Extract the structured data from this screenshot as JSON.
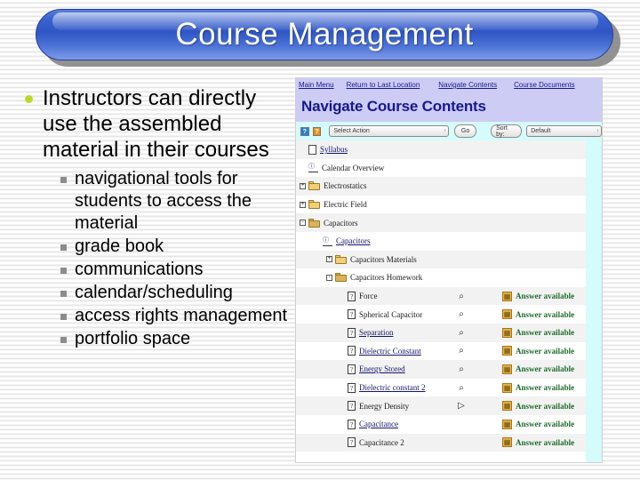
{
  "slide": {
    "title": "Course Management",
    "bullets": [
      {
        "level": 1,
        "text": "Instructors can directly use the assembled material in their courses"
      }
    ],
    "subbullets": [
      "navigational tools for students to access the material",
      "grade book",
      "communications",
      "calendar/scheduling",
      "access rights management",
      "portfolio space"
    ]
  },
  "screenshot": {
    "nav_links": [
      "Main Menu",
      "Return to Last Location",
      "Navigate Contents",
      "Course Documents"
    ],
    "page_header": "Navigate Course Contents",
    "toolbar": {
      "help_blue": "?",
      "help_orange": "?",
      "select_action": "Select Action",
      "go": "Go",
      "sort_by": "Sort by:",
      "sort_value": "Default",
      "arrows": "↕"
    },
    "answer_available_label": "Answer available",
    "tree": [
      {
        "label": "Syllabus",
        "indent": 0,
        "icon": "document-icon",
        "expander": "",
        "link": true,
        "preview": "",
        "answer": false
      },
      {
        "label": "Calendar Overview",
        "indent": 0,
        "icon": "calendar-icon",
        "expander": "",
        "link": false,
        "preview": "",
        "answer": false
      },
      {
        "label": "Electrostatics",
        "indent": 0,
        "icon": "folder-icon",
        "expander": "+",
        "link": false,
        "preview": "",
        "answer": false
      },
      {
        "label": "Electric Field",
        "indent": 0,
        "icon": "folder-icon",
        "expander": "+",
        "link": false,
        "preview": "",
        "answer": false
      },
      {
        "label": "Capacitors",
        "indent": 0,
        "icon": "folder-open-icon",
        "expander": "-",
        "link": false,
        "preview": "",
        "answer": false
      },
      {
        "label": "Capacitors",
        "indent": 1,
        "icon": "calendar-icon",
        "expander": "",
        "link": true,
        "preview": "",
        "answer": false
      },
      {
        "label": "Capacitors Materials",
        "indent": 2,
        "icon": "folder-icon",
        "expander": "+",
        "link": false,
        "preview": "",
        "answer": false
      },
      {
        "label": "Capacitors Homework",
        "indent": 2,
        "icon": "folder-open-icon",
        "expander": "-",
        "link": false,
        "preview": "",
        "answer": false
      },
      {
        "label": "Force",
        "indent": 3,
        "icon": "question-icon",
        "expander": "",
        "link": false,
        "preview": "preview-icon",
        "answer": true
      },
      {
        "label": "Spherical Capacitor",
        "indent": 3,
        "icon": "question-icon",
        "expander": "",
        "link": false,
        "preview": "preview-icon",
        "answer": true
      },
      {
        "label": "Separation",
        "indent": 3,
        "icon": "question-icon",
        "expander": "",
        "link": true,
        "preview": "preview-icon",
        "answer": true
      },
      {
        "label": "Dielectric Constant",
        "indent": 3,
        "icon": "question-icon",
        "expander": "",
        "link": true,
        "preview": "preview-icon",
        "answer": true
      },
      {
        "label": "Energy Stored",
        "indent": 3,
        "icon": "question-icon",
        "expander": "",
        "link": true,
        "preview": "preview-icon",
        "answer": true
      },
      {
        "label": "Dielectric constant 2",
        "indent": 3,
        "icon": "question-icon",
        "expander": "",
        "link": true,
        "preview": "preview-icon",
        "answer": true
      },
      {
        "label": "Energy Density",
        "indent": 3,
        "icon": "question-icon",
        "expander": "",
        "link": false,
        "preview": "play-icon",
        "answer": true
      },
      {
        "label": "Capacitance",
        "indent": 3,
        "icon": "question-icon",
        "expander": "",
        "link": true,
        "preview": "",
        "answer": true
      },
      {
        "label": "Capacitance 2",
        "indent": 3,
        "icon": "question-icon",
        "expander": "",
        "link": false,
        "preview": "",
        "answer": true
      }
    ]
  },
  "colors": {
    "title_blue": "#2f56c4",
    "bullet_green": "#bcd92b",
    "header_lavender": "#ccccf5",
    "header_navy": "#17178f",
    "app_cyan": "#d5fbfb",
    "answer_green": "#1d6b2a",
    "link_navy": "#14146b"
  }
}
